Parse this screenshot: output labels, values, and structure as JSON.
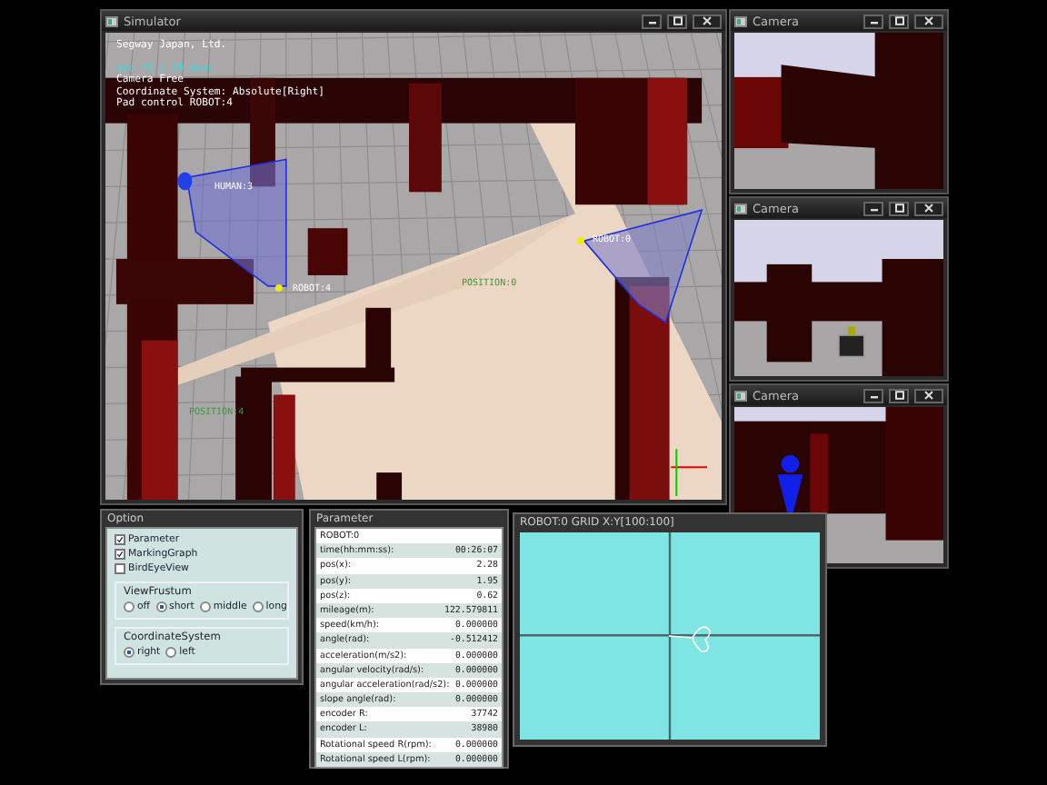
{
  "simulator": {
    "title": "Simulator",
    "overlay": [
      {
        "text": "Segway Japan, Ltd.",
        "color": "#ffffff"
      },
      {
        "text": "sec 49 / 49 msec",
        "color": "#40d8e0"
      },
      {
        "text": "Camera Free",
        "color": "#ffffff"
      },
      {
        "text": "Coordinate System: Absolute[Right]",
        "color": "#ffffff"
      },
      {
        "text": "Pad control ROBOT:4",
        "color": "#ffffff"
      }
    ],
    "scene_labels": [
      {
        "text": "HUMAN:3",
        "color": "#ffffff"
      },
      {
        "text": "ROBOT:4",
        "color": "#ffffff"
      },
      {
        "text": "ROBOT:0",
        "color": "#ffffff"
      },
      {
        "text": "POSITION:0",
        "color": "#3c9a3c"
      },
      {
        "text": "POSITION:4",
        "color": "#3c9a3c"
      }
    ]
  },
  "cameras": [
    {
      "title": "Camera",
      "kind": "wall"
    },
    {
      "title": "Camera",
      "kind": "robot"
    },
    {
      "title": "Camera",
      "kind": "human"
    }
  ],
  "option": {
    "title": "Option",
    "checkboxes": [
      {
        "label": "Parameter",
        "checked": true
      },
      {
        "label": "MarkingGraph",
        "checked": true
      },
      {
        "label": "BirdEyeView",
        "checked": false
      }
    ],
    "groups": [
      {
        "title": "ViewFrustum",
        "options": [
          {
            "label": "off",
            "selected": false
          },
          {
            "label": "short",
            "selected": true
          },
          {
            "label": "middle",
            "selected": false
          },
          {
            "label": "long",
            "selected": false
          }
        ]
      },
      {
        "title": "CoordinateSystem",
        "options": [
          {
            "label": "right",
            "selected": true
          },
          {
            "label": "left",
            "selected": false
          }
        ]
      }
    ]
  },
  "parameter": {
    "title": "Parameter",
    "header": "ROBOT:0",
    "rows": [
      {
        "name": "time(hh:mm:ss):",
        "value": "00:26:07"
      },
      {
        "name": "pos(x):",
        "value": "2.28"
      },
      {
        "name": "pos(y):",
        "value": "1.95"
      },
      {
        "name": "pos(z):",
        "value": "0.62"
      },
      {
        "name": "mileage(m):",
        "value": "122.579811"
      },
      {
        "name": "speed(km/h):",
        "value": "0.000000"
      },
      {
        "name": "angle(rad):",
        "value": "-0.512412"
      },
      {
        "name": "acceleration(m/s2):",
        "value": "0.000000"
      },
      {
        "name": "angular velocity(rad/s):",
        "value": "0.000000"
      },
      {
        "name": "angular acceleration(rad/s2):",
        "value": "0.000000"
      },
      {
        "name": "slope angle(rad):",
        "value": "0.000000"
      },
      {
        "name": "encoder R:",
        "value": "37742"
      },
      {
        "name": "encoder L:",
        "value": "38980"
      },
      {
        "name": "Rotational speed R(rpm):",
        "value": "0.000000"
      },
      {
        "name": "Rotational speed L(rpm):",
        "value": "0.000000"
      }
    ]
  },
  "grid_window": {
    "title": "ROBOT:0 GRID X:Y[100:100]"
  }
}
